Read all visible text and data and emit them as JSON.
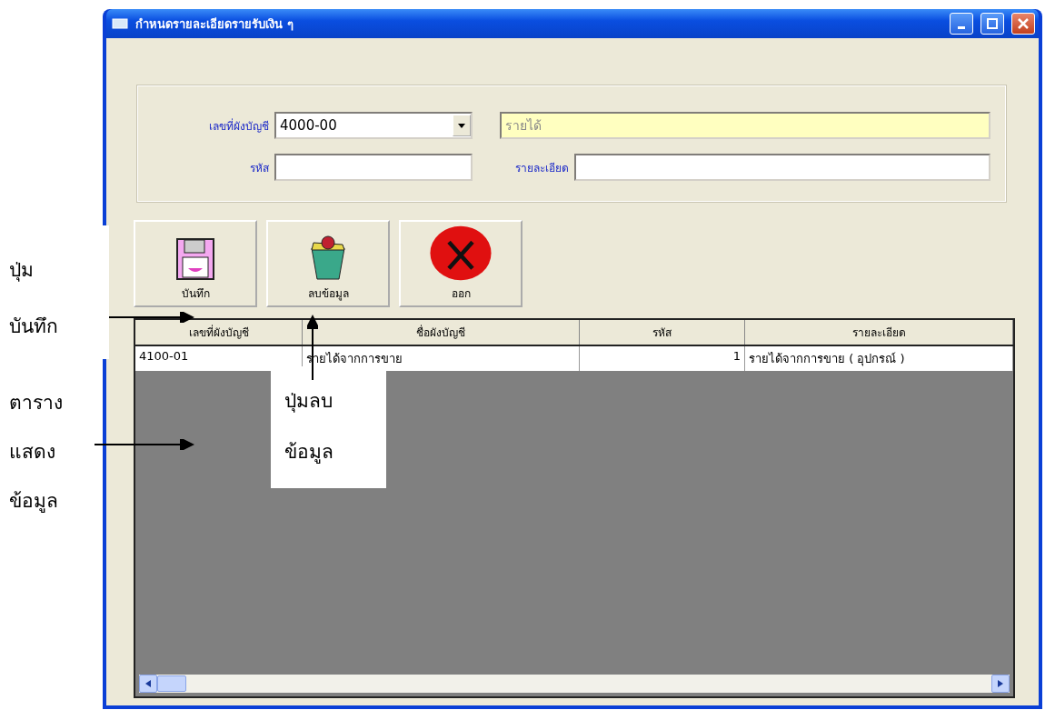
{
  "window": {
    "title": "กำหนดรายละเอียดรายรับเงิน ๆ"
  },
  "form": {
    "rows": [
      [
        {
          "label": "เลขที่ผังบัญชี",
          "kind": "combo",
          "value": "4000-00"
        },
        {
          "kind": "readonly",
          "value": "รายได้"
        }
      ],
      [
        {
          "label": "รหัส",
          "kind": "text"
        },
        {
          "label": "รายละเอียด",
          "kind": "text"
        }
      ]
    ]
  },
  "buttons": [
    {
      "label": "บันทึก",
      "kind": "save"
    },
    {
      "label": "ลบข้อมูล",
      "kind": "delete"
    },
    {
      "label": "ออก",
      "kind": "exit"
    }
  ],
  "table": {
    "columns": [
      {
        "label": "เลขที่ผังบัญชี"
      },
      {
        "label": "ชื่อผังบัญชี"
      },
      {
        "label": "รหัส"
      },
      {
        "label": "รายละเอียด"
      }
    ],
    "rows": [
      [
        "4100-01",
        "รายได้จากการขาย",
        "1",
        "รายได้จากการขาย ( อุปกรณ์ )"
      ]
    ]
  },
  "annotations": [
    {
      "kind": "save",
      "lines": [
        "ปุ่ม",
        "บันทึก"
      ]
    },
    {
      "kind": "table",
      "lines": [
        "ตาราง",
        "แสดง",
        "ข้อมูล"
      ]
    },
    {
      "kind": "delete",
      "lines": [
        "ปุ่มลบ",
        "ข้อมูล"
      ]
    }
  ]
}
